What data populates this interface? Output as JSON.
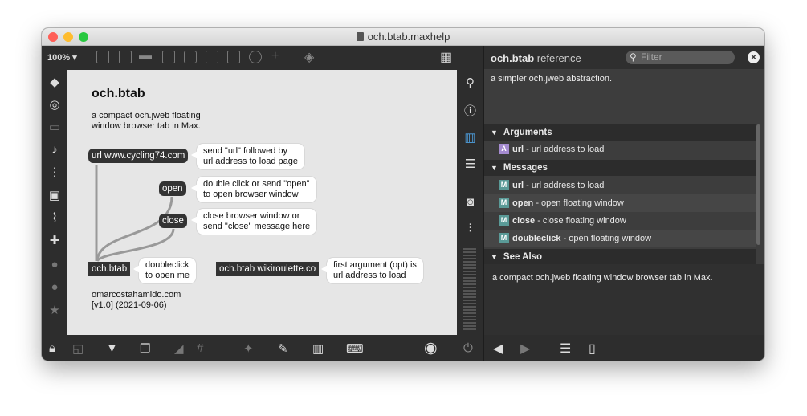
{
  "window": {
    "title": "och.btab.maxhelp",
    "traffic_lights": [
      "#ff5f57",
      "#febc2e",
      "#28c840"
    ]
  },
  "toolbar": {
    "zoom": "100%"
  },
  "patcher": {
    "title": "och.btab",
    "description": "a compact och.jweb floating\nwindow browser tab in Max.",
    "objects": {
      "url_msg": "url www.cycling74.com",
      "open_msg": "open",
      "close_msg": "close",
      "btab_obj": "och.btab",
      "btab_wiki_obj": "och.btab wikiroulette.co"
    },
    "comments": {
      "url_comment": "send \"url\" followed by\nurl address to load page",
      "open_comment": "double click or send \"open\"\nto open browser window",
      "close_comment": "close browser window or\nsend \"close\" message here",
      "btab_comment": "doubleclick\nto open me",
      "wiki_comment": "first argument (opt) is\nurl address to load"
    },
    "credit": "omarcostahamido.com\n[v1.0] (2021-09-06)"
  },
  "reference": {
    "object_name": "och.btab",
    "title_suffix": "reference",
    "filter_placeholder": "Filter",
    "digest": "a simpler och.jweb abstraction.",
    "sections": {
      "arguments": {
        "label": "Arguments",
        "items": [
          {
            "badge": "A",
            "name": "url",
            "desc": " - url address to load"
          }
        ]
      },
      "messages": {
        "label": "Messages",
        "items": [
          {
            "badge": "M",
            "name": "url",
            "desc": " - url address to load"
          },
          {
            "badge": "M",
            "name": "open",
            "desc": " - open floating window"
          },
          {
            "badge": "M",
            "name": "close",
            "desc": " - close floating window"
          },
          {
            "badge": "M",
            "name": "doubleclick",
            "desc": " - open floating window"
          }
        ]
      },
      "see_also": {
        "label": "See Also"
      }
    },
    "description": "a compact och.jweb floating window browser tab in Max.",
    "colors": {
      "argument_badge": "#a58bd0",
      "message_badge": "#5a9a97"
    }
  }
}
